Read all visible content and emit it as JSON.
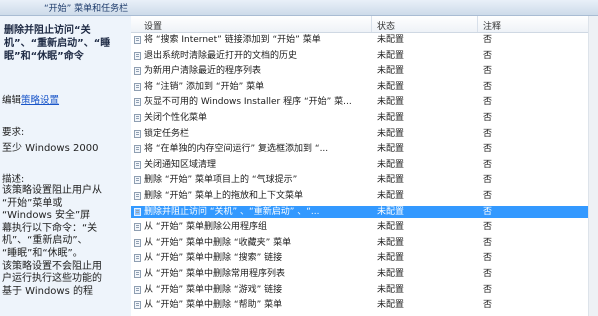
{
  "window": {
    "title": "“开始” 菜单和任务栏"
  },
  "left_pane": {
    "title": "删除并阻止访问“关机”、“重新启动”、“睡眠”和“休眠”命令",
    "edit_prefix": "编辑",
    "edit_link": "策略设置",
    "req_label": "要求:",
    "req_value": "至少 Windows 2000",
    "desc_label": "描述:",
    "desc_text": "该策略设置阻止用户从\n“开始”菜单或\n“Windows 安全”屏\n幕执行以下命令：“关\n机”、“重新启动”、\n“睡眠”和“休眠”。\n该策略设置不会阻止用\n户运行执行这些功能的\n基于 Windows 的程"
  },
  "table": {
    "columns": {
      "setting": "设置",
      "state": "状态",
      "note": "注释"
    },
    "rows": [
      {
        "name": "将 “搜索 Internet” 链接添加到 “开始” 菜单",
        "state": "未配置",
        "note": "否"
      },
      {
        "name": "退出系统时清除最近打开的文档的历史",
        "state": "未配置",
        "note": "否"
      },
      {
        "name": "为新用户清除最近的程序列表",
        "state": "未配置",
        "note": "否"
      },
      {
        "name": "将 “注销” 添加到 “开始” 菜单",
        "state": "未配置",
        "note": "否"
      },
      {
        "name": "灰显不可用的 Windows Installer 程序 “开始” 菜...",
        "state": "未配置",
        "note": "否"
      },
      {
        "name": "关闭个性化菜单",
        "state": "未配置",
        "note": "否"
      },
      {
        "name": "锁定任务栏",
        "state": "未配置",
        "note": "否"
      },
      {
        "name": "将 “在单独的内存空间运行” 复选框添加到 “...",
        "state": "未配置",
        "note": "否"
      },
      {
        "name": "关闭通知区域清理",
        "state": "未配置",
        "note": "否"
      },
      {
        "name": "删除 “开始” 菜单项目上的 “气球提示”",
        "state": "未配置",
        "note": "否"
      },
      {
        "name": "删除 “开始” 菜单上的拖放和上下文菜单",
        "state": "未配置",
        "note": "否"
      },
      {
        "name": "删除并阻止访问 “关机” 、“重新启动” 、“...",
        "state": "未配置",
        "note": "否",
        "selected": true
      },
      {
        "name": "从 “开始” 菜单删除公用程序组",
        "state": "未配置",
        "note": "否"
      },
      {
        "name": "从 “开始” 菜单中删除 “收藏夹” 菜单",
        "state": "未配置",
        "note": "否"
      },
      {
        "name": "从 “开始” 菜单中删除 “搜索” 链接",
        "state": "未配置",
        "note": "否"
      },
      {
        "name": "从 “开始” 菜单中删除常用程序列表",
        "state": "未配置",
        "note": "否"
      },
      {
        "name": "从 “开始” 菜单中删除 “游戏” 链接",
        "state": "未配置",
        "note": "否"
      },
      {
        "name": "从 “开始” 菜单中删除 “帮助” 菜单",
        "state": "未配置",
        "note": "否"
      }
    ]
  }
}
